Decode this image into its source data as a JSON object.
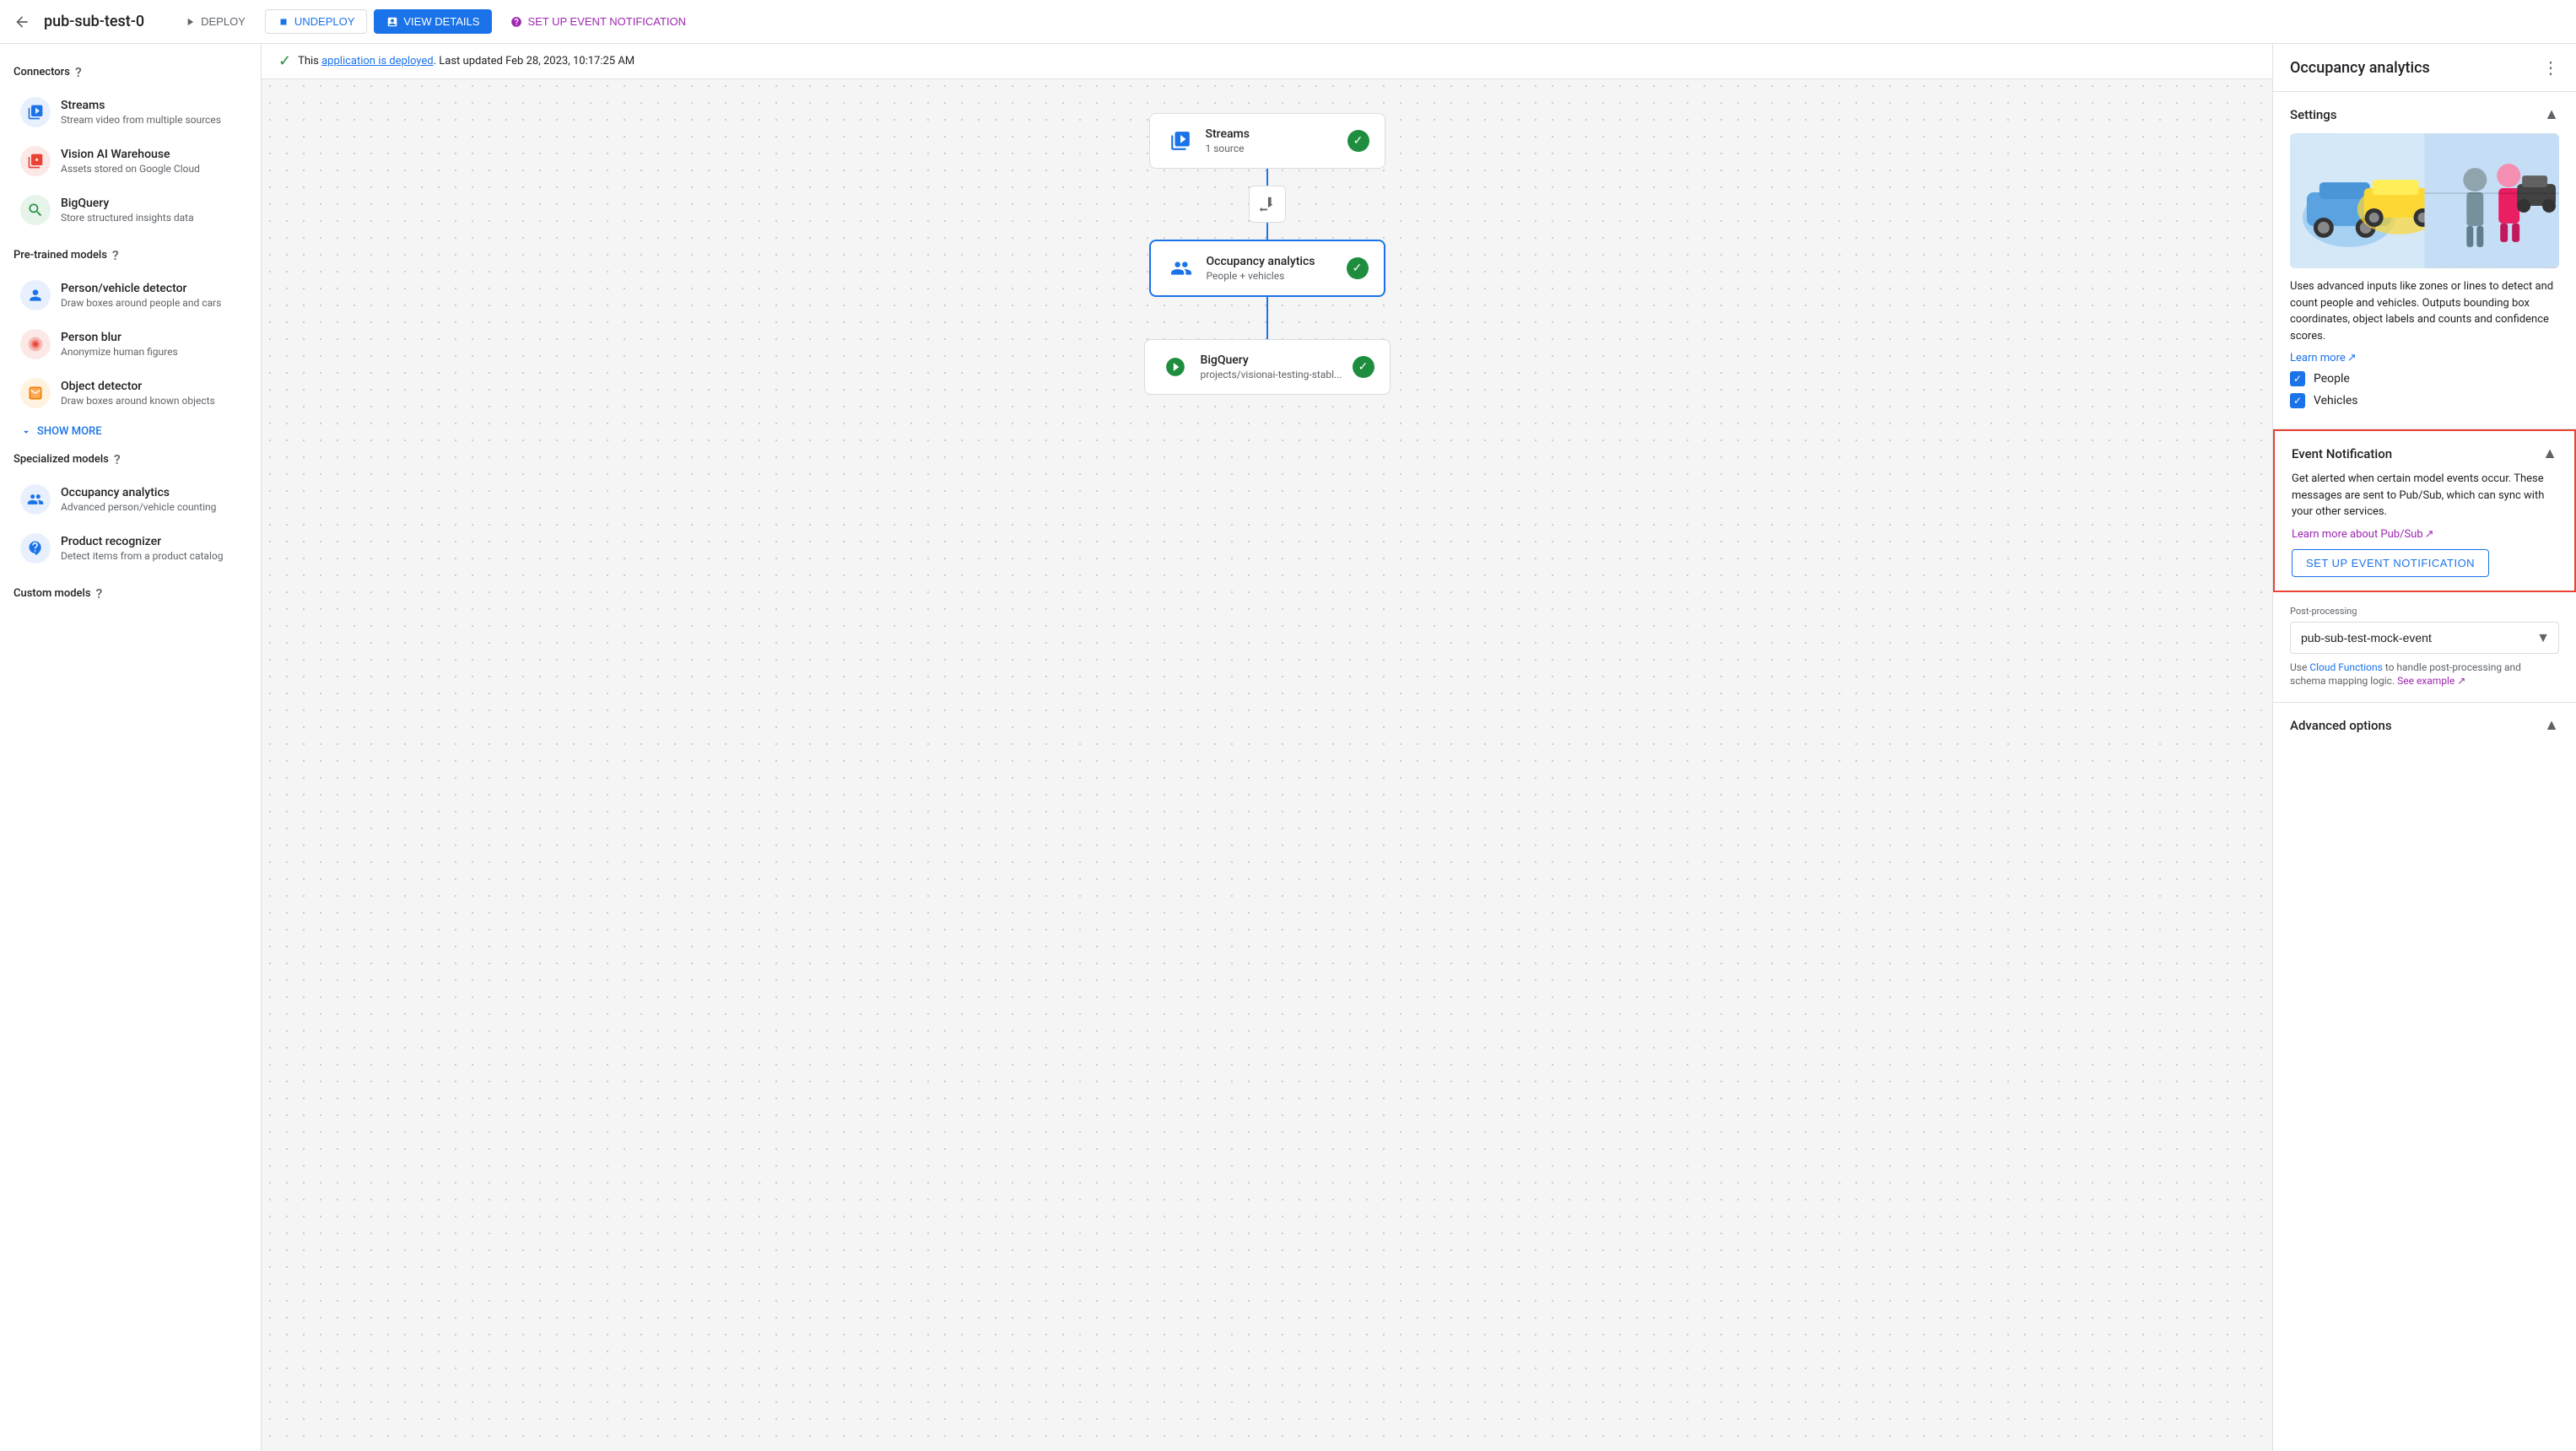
{
  "topbar": {
    "back_icon": "←",
    "title": "pub-sub-test-0",
    "deploy_label": "DEPLOY",
    "undeploy_label": "UNDEPLOY",
    "view_details_label": "VIEW DETAILS",
    "setup_event_label": "SET UP EVENT NOTIFICATION"
  },
  "status_bar": {
    "message_prefix": "This",
    "link_text": "application is deployed",
    "message_suffix": ". Last updated Feb 28, 2023, 10:17:25 AM"
  },
  "sidebar": {
    "connectors_label": "Connectors",
    "items_connectors": [
      {
        "name": "Streams",
        "desc": "Stream video from multiple sources",
        "icon": "streams"
      },
      {
        "name": "Vision AI Warehouse",
        "desc": "Assets stored on Google Cloud",
        "icon": "vision"
      },
      {
        "name": "BigQuery",
        "desc": "Store structured insights data",
        "icon": "bigquery"
      }
    ],
    "pretrained_label": "Pre-trained models",
    "items_pretrained": [
      {
        "name": "Person/vehicle detector",
        "desc": "Draw boxes around people and cars",
        "icon": "person"
      },
      {
        "name": "Person blur",
        "desc": "Anonymize human figures",
        "icon": "blur"
      },
      {
        "name": "Object detector",
        "desc": "Draw boxes around known objects",
        "icon": "object"
      }
    ],
    "show_more_label": "SHOW MORE",
    "specialized_label": "Specialized models",
    "items_specialized": [
      {
        "name": "Occupancy analytics",
        "desc": "Advanced person/vehicle counting",
        "icon": "occupancy"
      },
      {
        "name": "Product recognizer",
        "desc": "Detect items from a product catalog",
        "icon": "product"
      }
    ],
    "custom_label": "Custom models"
  },
  "flow": {
    "nodes": [
      {
        "id": "streams",
        "name": "Streams",
        "sub": "1 source",
        "icon": "📹",
        "checked": true
      },
      {
        "id": "occupancy",
        "name": "Occupancy analytics",
        "sub": "People + vehicles",
        "icon": "👥",
        "checked": true,
        "selected": true
      },
      {
        "id": "bigquery",
        "name": "BigQuery",
        "sub": "projects/visionai-testing-stabl...",
        "icon": "◎",
        "checked": true
      }
    ]
  },
  "right_panel": {
    "title": "Occupancy analytics",
    "menu_icon": "⋮",
    "settings": {
      "title": "Settings",
      "description": "Uses advanced inputs like zones or lines to detect and count people and vehicles. Outputs bounding box coordinates, object labels and counts and confidence scores.",
      "learn_more": "Learn more",
      "checkboxes": [
        {
          "label": "People",
          "checked": true
        },
        {
          "label": "Vehicles",
          "checked": true
        }
      ]
    },
    "event_notification": {
      "title": "Event Notification",
      "description": "Get alerted when certain model events occur. These messages are sent to Pub/Sub, which can sync with your other services.",
      "link_text": "Learn more about Pub/Sub",
      "setup_btn_label": "SET UP EVENT NOTIFICATION"
    },
    "post_processing": {
      "label": "Post-processing",
      "value": "pub-sub-test-mock-event",
      "description": "Use Cloud Functions to handle post-processing and schema mapping logic.",
      "see_example": "See example"
    },
    "advanced": {
      "title": "Advanced options"
    }
  }
}
